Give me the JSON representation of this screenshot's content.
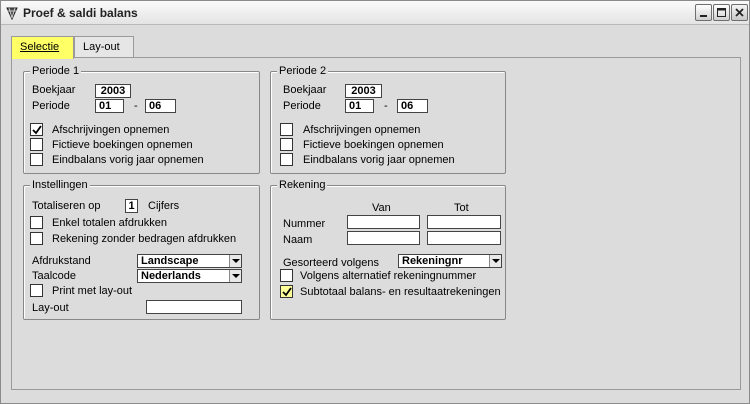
{
  "window": {
    "title": "Proef & saldi balans"
  },
  "tabs": [
    {
      "label": "Selectie",
      "active": true
    },
    {
      "label": "Lay-out",
      "active": false
    }
  ],
  "periode1": {
    "title": "Periode 1",
    "boekjaar_label": "Boekjaar",
    "boekjaar_value": "2003",
    "periode_label": "Periode",
    "periode_from": "01",
    "separator": "-",
    "periode_to": "06",
    "checks": [
      {
        "label": "Afschrijvingen opnemen",
        "checked": true
      },
      {
        "label": "Fictieve boekingen opnemen",
        "checked": false
      },
      {
        "label": "Eindbalans vorig jaar opnemen",
        "checked": false
      }
    ]
  },
  "periode2": {
    "title": "Periode 2",
    "boekjaar_label": "Boekjaar",
    "boekjaar_value": "2003",
    "periode_label": "Periode",
    "periode_from": "01",
    "separator": "-",
    "periode_to": "06",
    "checks": [
      {
        "label": "Afschrijvingen opnemen",
        "checked": false
      },
      {
        "label": "Fictieve boekingen opnemen",
        "checked": false
      },
      {
        "label": "Eindbalans vorig jaar opnemen",
        "checked": false
      }
    ]
  },
  "instellingen": {
    "title": "Instellingen",
    "totaliseren_label": "Totaliseren op",
    "totaliseren_value": "1",
    "cijfers_label": "Cijfers",
    "checks": [
      {
        "label": "Enkel totalen afdrukken",
        "checked": false
      },
      {
        "label": "Rekening zonder bedragen afdrukken",
        "checked": false
      }
    ],
    "afdrukstand_label": "Afdrukstand",
    "afdrukstand_value": "Landscape",
    "taalcode_label": "Taalcode",
    "taalcode_value": "Nederlands",
    "print_layout_label": "Print met lay-out",
    "print_layout_checked": false,
    "layout_label": "Lay-out",
    "layout_value": ""
  },
  "rekening": {
    "title": "Rekening",
    "van_label": "Van",
    "tot_label": "Tot",
    "nummer_label": "Nummer",
    "naam_label": "Naam",
    "nummer_van": "",
    "nummer_tot": "",
    "naam_van": "",
    "naam_tot": "",
    "gesorteerd_label": "Gesorteerd volgens",
    "gesorteerd_value": "Rekeningnr",
    "checks": [
      {
        "label": "Volgens alternatief rekeningnummer",
        "checked": false
      },
      {
        "label": "Subtotaal balans- en resultaatrekeningen",
        "checked": true
      }
    ]
  },
  "colors": {
    "active_tab": "#ffff66",
    "check_highlight": "#ffff99"
  }
}
